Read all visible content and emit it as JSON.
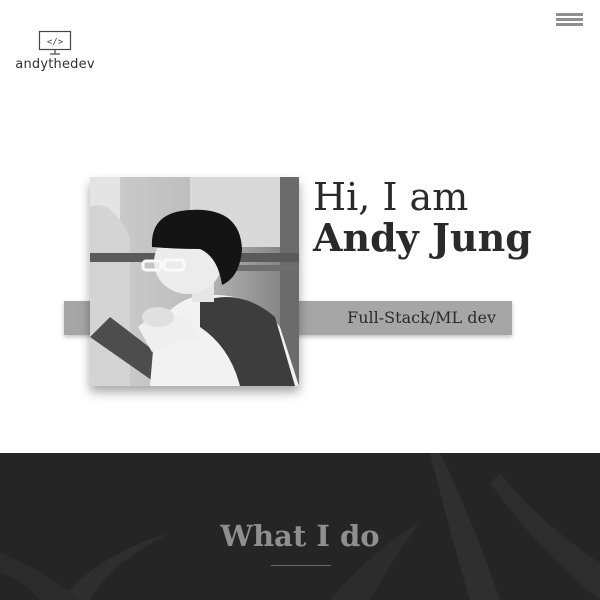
{
  "header": {
    "logo_glyph": "</>",
    "logo_text": "andythedev",
    "menu_icon": "hamburger-menu-icon"
  },
  "hero": {
    "greeting": "Hi, I am",
    "name": "Andy Jung",
    "role": "Full-Stack/ML dev",
    "portrait": "portrait-photo"
  },
  "section": {
    "title": "What I do"
  },
  "colors": {
    "background": "#ffffff",
    "band": "#a6a6a6",
    "dark_section": "#252525",
    "heading_text": "#2a2a2a"
  }
}
